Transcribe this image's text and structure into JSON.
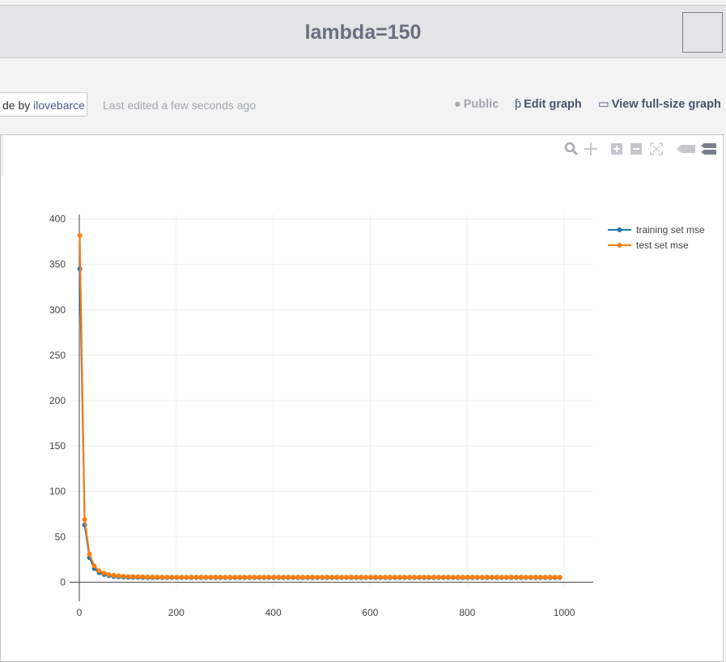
{
  "header": {
    "title": "lambda=150"
  },
  "meta": {
    "author_prefix": "de by",
    "author_name": "ilovebarce",
    "last_edited": "Last edited a few seconds ago",
    "public_label": "Public",
    "edit_label": "Edit graph",
    "view_label": "View full-size graph"
  },
  "modebar": [
    "zoom-icon",
    "pan-icon",
    "zoom-in-icon",
    "zoom-out-icon",
    "autoscale-icon",
    "hover-closest-icon",
    "hover-compare-icon"
  ],
  "chart_data": {
    "type": "line",
    "title": "",
    "xlabel": "",
    "ylabel": "",
    "xlim": [
      -20,
      1060
    ],
    "ylim": [
      -5,
      405
    ],
    "xticks": [
      0,
      200,
      400,
      600,
      800,
      1000
    ],
    "yticks": [
      0,
      50,
      100,
      150,
      200,
      250,
      300,
      350,
      400
    ],
    "grid": true,
    "legend_position": "top-right",
    "x": [
      1,
      11,
      21,
      31,
      41,
      51,
      61,
      71,
      81,
      91,
      101,
      111,
      121,
      131,
      141,
      151,
      161,
      171,
      181,
      191,
      201,
      211,
      221,
      231,
      241,
      251,
      261,
      271,
      281,
      291,
      301,
      311,
      321,
      331,
      341,
      351,
      361,
      371,
      381,
      391,
      401,
      411,
      421,
      431,
      441,
      451,
      461,
      471,
      481,
      491,
      501,
      511,
      521,
      531,
      541,
      551,
      561,
      571,
      581,
      591,
      601,
      611,
      621,
      631,
      641,
      651,
      661,
      671,
      681,
      691,
      701,
      711,
      721,
      731,
      741,
      751,
      761,
      771,
      781,
      791,
      801,
      811,
      821,
      831,
      841,
      851,
      861,
      871,
      881,
      891,
      901,
      911,
      921,
      931,
      941,
      951,
      961,
      971,
      981,
      991
    ],
    "series": [
      {
        "name": "training set mse",
        "color": "#1f77b4",
        "values": [
          345,
          63,
          27,
          15,
          10.5,
          8.5,
          7.2,
          6.4,
          5.9,
          5.6,
          5.4,
          5.3,
          5.2,
          5.1,
          5.05,
          5.0,
          5.0,
          5.0,
          5.0,
          5.0,
          5.0,
          5.0,
          5.0,
          5.0,
          5.0,
          5.0,
          5.0,
          5.0,
          5.0,
          5.0,
          5.0,
          5.0,
          5.0,
          5.0,
          5.0,
          5.0,
          5.0,
          5.0,
          5.0,
          5.0,
          5.0,
          5.0,
          5.0,
          5.0,
          5.0,
          5.0,
          5.0,
          5.0,
          5.0,
          5.0,
          5.0,
          5.0,
          5.0,
          5.0,
          5.0,
          5.0,
          5.0,
          5.0,
          5.0,
          5.0,
          5.0,
          5.0,
          5.0,
          5.0,
          5.0,
          5.0,
          5.0,
          5.0,
          5.0,
          5.0,
          5.0,
          5.0,
          5.0,
          5.0,
          5.0,
          5.0,
          5.0,
          5.0,
          5.0,
          5.0,
          5.0,
          5.0,
          5.0,
          5.0,
          5.0,
          5.0,
          5.0,
          5.0,
          5.0,
          5.0,
          5.0,
          5.0,
          5.0,
          5.0,
          5.0,
          5.0,
          5.0,
          5.0,
          5.0,
          5.0
        ]
      },
      {
        "name": "test set mse",
        "color": "#ff7f0e",
        "values": [
          382,
          69,
          31,
          18,
          12.5,
          10,
          8.5,
          7.6,
          7.0,
          6.6,
          6.3,
          6.1,
          6.0,
          5.9,
          5.8,
          5.75,
          5.7,
          5.65,
          5.6,
          5.6,
          5.6,
          5.6,
          5.6,
          5.6,
          5.6,
          5.6,
          5.6,
          5.6,
          5.6,
          5.6,
          5.6,
          5.6,
          5.6,
          5.6,
          5.6,
          5.6,
          5.6,
          5.6,
          5.6,
          5.6,
          5.6,
          5.6,
          5.6,
          5.6,
          5.6,
          5.6,
          5.6,
          5.6,
          5.6,
          5.6,
          5.6,
          5.6,
          5.6,
          5.6,
          5.6,
          5.6,
          5.6,
          5.6,
          5.6,
          5.6,
          5.6,
          5.6,
          5.6,
          5.6,
          5.6,
          5.6,
          5.6,
          5.6,
          5.6,
          5.6,
          5.6,
          5.6,
          5.6,
          5.6,
          5.6,
          5.6,
          5.6,
          5.6,
          5.6,
          5.6,
          5.6,
          5.6,
          5.6,
          5.6,
          5.6,
          5.6,
          5.6,
          5.6,
          5.6,
          5.6,
          5.6,
          5.6,
          5.6,
          5.6,
          5.6,
          5.6,
          5.6,
          5.6,
          5.6,
          5.6
        ]
      }
    ]
  }
}
